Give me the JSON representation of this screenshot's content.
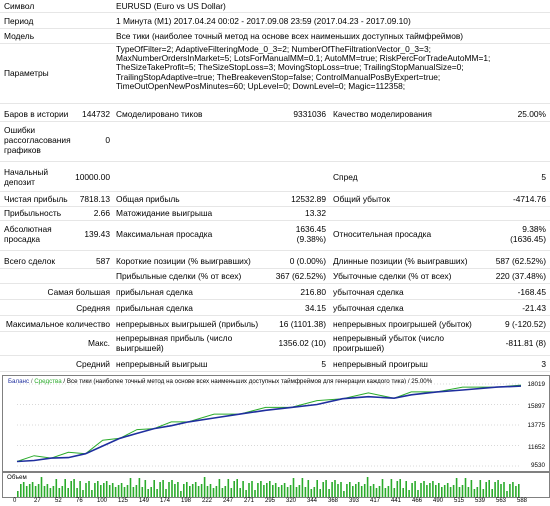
{
  "report": {
    "symbol": {
      "label": "Символ",
      "value": "EURUSD (Euro vs US Dollar)"
    },
    "period": {
      "label": "Период",
      "value": "1 Минута (M1) 2017.04.24 00:02 - 2017.09.08 23:59 (2017.04.23 - 2017.09.10)"
    },
    "model": {
      "label": "Модель",
      "value": "Все тики (наиболее точный метод на основе всех наименьших доступных таймфреймов)"
    },
    "params": {
      "label": "Параметры",
      "value": "TypeOfFilter=2; AdaptiveFilteringMode_0_3=2; NumberOfTheFiltrationVector_0_3=3; MaxNumberOrdersInMarket=5; LotsForManualMM=0.1; AutoMM=true; RiskPercForTradeAutoMM=1; TheSizeTakeProfit=5; TheSizeStopLoss=3; MovingStopLoss=true; TrailingStopManualSize=0; TrailingStopAdaptive=true; TheBreakevenStop=false; ControlManualPosByExpert=true; TimeOutOpenNewPosMinutes=60; UpLevel=0; DownLevel=0; Magic=112358;"
    },
    "bars": {
      "label": "Баров в истории",
      "value": "144732",
      "ticks_label": "Смоделировано тиков",
      "ticks_value": "9331036",
      "quality_label": "Качество моделирования",
      "quality_value": "25.00%"
    },
    "errors": {
      "label": "Ошибки рассогласования графиков",
      "value": "0"
    },
    "deposit": {
      "label": "Начальный депозит",
      "value": "10000.00",
      "spread_label": "Спред",
      "spread_value": "5"
    },
    "profit": {
      "net_label": "Чистая прибыль",
      "net_value": "7818.13",
      "gross_label": "Общая прибыль",
      "gross_value": "12532.89",
      "loss_label": "Общий убыток",
      "loss_value": "-4714.76"
    },
    "factor": {
      "label": "Прибыльность",
      "value": "2.66",
      "payoff_label": "Матожидание выигрыша",
      "payoff_value": "13.32"
    },
    "drawdown": {
      "abs_label": "Абсолютная просадка",
      "abs_value": "139.43",
      "max_label": "Максимальная просадка",
      "max_value": "1636.45",
      "max_value2": "(9.38%)",
      "rel_label": "Относительная просадка",
      "rel_value": "9.38%",
      "rel_value2": "(1636.45)"
    },
    "trades": {
      "total_label": "Всего сделок",
      "total_value": "587",
      "short_label": "Короткие позиции (% выигравших)",
      "short_value": "0 (0.00%)",
      "long_label": "Длинные позиции (% выигравших)",
      "long_value": "587 (62.52%)"
    },
    "pl": {
      "win_label": "Прибыльные сделки (% от всех)",
      "win_value": "367 (62.52%)",
      "lose_label": "Убыточные сделки (% от всех)",
      "lose_value": "220 (37.48%)"
    },
    "largest": {
      "label1": "Самая большая",
      "label2": "прибыльная сделка",
      "value2": "216.80",
      "label3": "убыточная сделка",
      "value3": "-168.45"
    },
    "average": {
      "label1": "Средняя",
      "label2": "прибыльная сделка",
      "value2": "34.15",
      "label3": "убыточная сделка",
      "value3": "-21.43"
    },
    "maxcount": {
      "label1": "Максимальное количество",
      "label2": "непрерывных выигрышей (прибыль)",
      "value2": "16 (1101.38)",
      "label3": "непрерывных проигрышей (убыток)",
      "value3": "9 (-120.52)"
    },
    "maxsum": {
      "label1": "Макс.",
      "label2": "непрерывная прибыль (число выигрышей)",
      "value2": "1356.02 (10)",
      "label3": "непрерывный убыток (число проигрышей)",
      "value3": "-811.81 (8)"
    },
    "avgcount": {
      "label1": "Средний",
      "label2": "непрерывный выигрыш",
      "value2": "5",
      "label3": "непрерывный проигрыш",
      "value3": "3"
    }
  },
  "chart": {
    "legend_balance": "Баланс",
    "legend_equity": "Средства",
    "legend_rest": "/ Все тики (наиболее точный метод на основе всех наименьших доступных таймфреймов для генерации каждого тика) / 25.00%",
    "volume_label": "Объем",
    "colors": {
      "balance": "#1f2f9e",
      "equity": "#2bab2b",
      "volume": "#2bab2b"
    }
  },
  "chart_data": {
    "type": "line",
    "ylim": [
      9530,
      18019
    ],
    "yticks": [
      "18019",
      "15897",
      "13775",
      "11652",
      "9530"
    ],
    "xticks": [
      "0",
      "27",
      "52",
      "76",
      "100",
      "125",
      "149",
      "174",
      "198",
      "222",
      "247",
      "271",
      "295",
      "320",
      "344",
      "368",
      "393",
      "417",
      "441",
      "466",
      "490",
      "515",
      "539",
      "563",
      "588"
    ],
    "xlim": [
      0,
      588
    ],
    "series": [
      {
        "name": "Баланс",
        "x": [
          0,
          20,
          40,
          60,
          80,
          100,
          120,
          140,
          160,
          180,
          200,
          230,
          260,
          290,
          320,
          350,
          380,
          410,
          440,
          460,
          490,
          520,
          560,
          588
        ],
        "values": [
          10000,
          10100,
          10350,
          10400,
          10800,
          11600,
          12400,
          12900,
          13400,
          13700,
          14100,
          14500,
          14900,
          15300,
          15600,
          15900,
          16500,
          16700,
          16550,
          16900,
          17200,
          17400,
          17700,
          17800
        ]
      },
      {
        "name": "Средства",
        "x": [
          0,
          20,
          40,
          60,
          80,
          100,
          120,
          140,
          160,
          180,
          200,
          230,
          260,
          290,
          320,
          350,
          380,
          410,
          440,
          460,
          490,
          520,
          560,
          588
        ],
        "values": [
          10000,
          10600,
          10350,
          10950,
          10800,
          12200,
          12400,
          13300,
          13400,
          14100,
          14100,
          14900,
          14900,
          15600,
          15600,
          16300,
          16500,
          17100,
          16550,
          17200,
          17200,
          17700,
          17700,
          17900
        ]
      }
    ]
  }
}
